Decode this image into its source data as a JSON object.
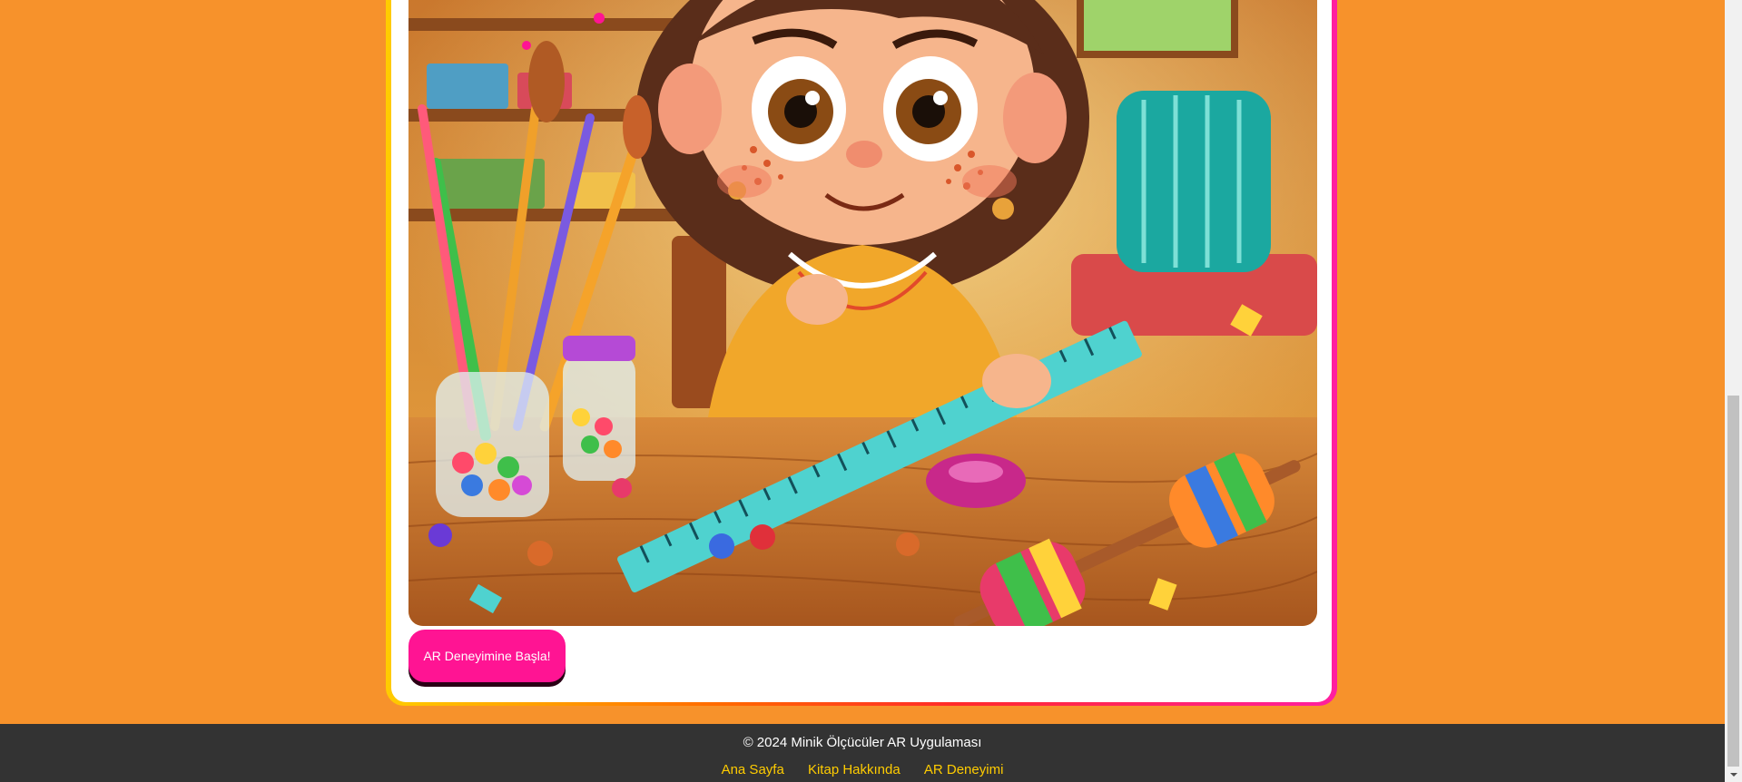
{
  "main": {
    "illustration_alt": "Girl measuring with a ruler at a craft table",
    "ar_button_label": "AR Deneyimine Başla!"
  },
  "footer": {
    "copyright": "© 2024 Minik Ölçücüler AR Uygulaması",
    "links": [
      "Ana Sayfa",
      "Kitap Hakkında",
      "AR Deneyimi"
    ]
  },
  "colors": {
    "page_bg": "#f7922b",
    "button": "#ff1493",
    "footer_bg": "#333333",
    "footer_link": "#ffcc00"
  },
  "icons": {
    "scroll_down": "chevron-down-icon"
  }
}
